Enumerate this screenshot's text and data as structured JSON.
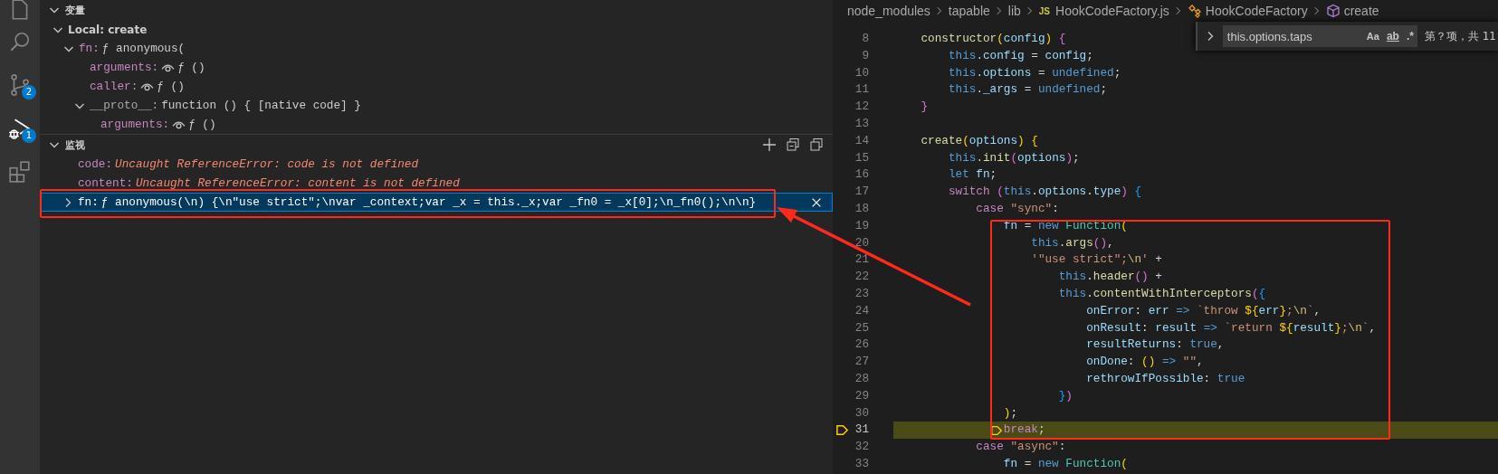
{
  "activity_bar": [
    {
      "kind": "explorer",
      "selected": false
    },
    {
      "kind": "search",
      "selected": false
    },
    {
      "kind": "scm",
      "badge": "2",
      "selected": false
    },
    {
      "kind": "debug",
      "badge": "1",
      "selected": true
    },
    {
      "kind": "extensions",
      "selected": false
    }
  ],
  "variables": {
    "title": "变量",
    "expanded": true,
    "scopes": [
      {
        "label": "Local: create",
        "expanded": true,
        "children": [
          {
            "name": "fn:",
            "value": "ƒ anonymous(",
            "lazy": false,
            "dimmed": false,
            "expanded": true,
            "children": [
              {
                "name": "arguments:",
                "value": "ƒ ()",
                "lazy": true,
                "dimmed": false
              },
              {
                "name": "caller:",
                "value": "ƒ ()",
                "lazy": true,
                "dimmed": false
              },
              {
                "name": "__proto__:",
                "value": "function () { [native code] }",
                "lazy": false,
                "dimmed": true,
                "expanded": true,
                "children": [
                  {
                    "name": "arguments:",
                    "value": "ƒ ()",
                    "lazy": true,
                    "dimmed": false
                  }
                ]
              }
            ]
          }
        ]
      }
    ]
  },
  "watch": {
    "title": "监视",
    "expanded": true,
    "items": [
      {
        "name": "code:",
        "value": "Uncaught ReferenceError: code is not defined",
        "kind": "error",
        "selected": false
      },
      {
        "name": "content:",
        "value": "Uncaught ReferenceError: content is not defined",
        "kind": "error",
        "selected": false
      },
      {
        "name": "fn:",
        "value": "ƒ anonymous(\\n) {\\n\"use strict\";\\nvar _context;var _x = this._x;var _fn0 = _x[0];\\n_fn0();\\n\\n}",
        "kind": "value",
        "selected": true,
        "expanded": false
      }
    ]
  },
  "breadcrumb": [
    {
      "label": "node_modules",
      "kind": "folder"
    },
    {
      "label": "tapable",
      "kind": "folder"
    },
    {
      "label": "lib",
      "kind": "folder"
    },
    {
      "label": "HookCodeFactory.js",
      "kind": "file",
      "badge": "JS"
    },
    {
      "label": "HookCodeFactory",
      "kind": "class"
    },
    {
      "label": "create",
      "kind": "method"
    }
  ],
  "find_widget": {
    "expanded": false,
    "query": "this.options.taps",
    "options": [
      {
        "label": "Aa",
        "kind": "case"
      },
      {
        "label": "ab",
        "kind": "word"
      },
      {
        "label": ".*",
        "kind": "regex"
      }
    ],
    "result": "第？项，共 11"
  },
  "code": {
    "lines": [
      {
        "number": "8",
        "current": false,
        "tokens": [
          {
            "text": "    constructor",
            "kind": "fn"
          },
          {
            "text": "(",
            "kind": "b1"
          },
          {
            "text": "config",
            "kind": "var"
          },
          {
            "text": ")",
            "kind": "b1"
          },
          {
            "text": " {",
            "kind": "b2"
          }
        ]
      },
      {
        "number": "9",
        "current": false,
        "tokens": [
          {
            "text": "        this",
            "kind": "kw"
          },
          {
            "text": ".",
            "kind": "p"
          },
          {
            "text": "config",
            "kind": "var"
          },
          {
            "text": " = ",
            "kind": "p"
          },
          {
            "text": "config",
            "kind": "var"
          },
          {
            "text": ";",
            "kind": "p"
          }
        ]
      },
      {
        "number": "10",
        "current": false,
        "tokens": [
          {
            "text": "        this",
            "kind": "kw"
          },
          {
            "text": ".",
            "kind": "p"
          },
          {
            "text": "options",
            "kind": "var"
          },
          {
            "text": " = ",
            "kind": "p"
          },
          {
            "text": "undefined",
            "kind": "kw"
          },
          {
            "text": ";",
            "kind": "p"
          }
        ]
      },
      {
        "number": "11",
        "current": false,
        "tokens": [
          {
            "text": "        this",
            "kind": "kw"
          },
          {
            "text": ".",
            "kind": "p"
          },
          {
            "text": "_args",
            "kind": "var"
          },
          {
            "text": " = ",
            "kind": "p"
          },
          {
            "text": "undefined",
            "kind": "kw"
          },
          {
            "text": ";",
            "kind": "p"
          }
        ]
      },
      {
        "number": "12",
        "current": false,
        "tokens": [
          {
            "text": "    }",
            "kind": "b2"
          }
        ]
      },
      {
        "number": "13",
        "current": false
      },
      {
        "number": "14",
        "current": false,
        "tokens": [
          {
            "text": "    create",
            "kind": "fn"
          },
          {
            "text": "(",
            "kind": "b1"
          },
          {
            "text": "options",
            "kind": "var"
          },
          {
            "text": ")",
            "kind": "b1"
          },
          {
            "text": " {",
            "kind": "b1"
          }
        ]
      },
      {
        "number": "15",
        "current": false,
        "tokens": [
          {
            "text": "        this",
            "kind": "kw"
          },
          {
            "text": ".",
            "kind": "p"
          },
          {
            "text": "init",
            "kind": "fn"
          },
          {
            "text": "(",
            "kind": "b2"
          },
          {
            "text": "options",
            "kind": "var"
          },
          {
            "text": ")",
            "kind": "b2"
          },
          {
            "text": ";",
            "kind": "p"
          }
        ]
      },
      {
        "number": "16",
        "current": false,
        "tokens": [
          {
            "text": "        let",
            "kind": "kw"
          },
          {
            "text": " fn",
            "kind": "var"
          },
          {
            "text": ";",
            "kind": "p"
          }
        ]
      },
      {
        "number": "17",
        "current": false,
        "tokens": [
          {
            "text": "        switch",
            "kind": "ctl"
          },
          {
            "text": " (",
            "kind": "b2"
          },
          {
            "text": "this",
            "kind": "kw"
          },
          {
            "text": ".",
            "kind": "p"
          },
          {
            "text": "options",
            "kind": "var"
          },
          {
            "text": ".",
            "kind": "p"
          },
          {
            "text": "type",
            "kind": "var"
          },
          {
            "text": ")",
            "kind": "b2"
          },
          {
            "text": " {",
            "kind": "b3"
          }
        ]
      },
      {
        "number": "18",
        "current": false,
        "tokens": [
          {
            "text": "            case",
            "kind": "ctl"
          },
          {
            "text": " \"sync\"",
            "kind": "str"
          },
          {
            "text": ":",
            "kind": "p"
          }
        ]
      },
      {
        "number": "19",
        "current": false,
        "tokens": [
          {
            "text": "                fn",
            "kind": "var"
          },
          {
            "text": " = ",
            "kind": "p"
          },
          {
            "text": "new",
            "kind": "kw"
          },
          {
            "text": " Function",
            "kind": "cls"
          },
          {
            "text": "(",
            "kind": "b1"
          }
        ]
      },
      {
        "number": "20",
        "current": false,
        "tokens": [
          {
            "text": "                    this",
            "kind": "kw"
          },
          {
            "text": ".",
            "kind": "p"
          },
          {
            "text": "args",
            "kind": "fn"
          },
          {
            "text": "()",
            "kind": "b2"
          },
          {
            "text": ",",
            "kind": "p"
          }
        ]
      },
      {
        "number": "21",
        "current": false,
        "tokens": [
          {
            "text": "                    '\"use strict\";",
            "kind": "str"
          },
          {
            "text": "\\n",
            "kind": "esc"
          },
          {
            "text": "'",
            "kind": "str"
          },
          {
            "text": " +",
            "kind": "p"
          }
        ]
      },
      {
        "number": "22",
        "current": false,
        "tokens": [
          {
            "text": "                        this",
            "kind": "kw"
          },
          {
            "text": ".",
            "kind": "p"
          },
          {
            "text": "header",
            "kind": "fn"
          },
          {
            "text": "()",
            "kind": "b2"
          },
          {
            "text": " +",
            "kind": "p"
          }
        ]
      },
      {
        "number": "23",
        "current": false,
        "tokens": [
          {
            "text": "                        this",
            "kind": "kw"
          },
          {
            "text": ".",
            "kind": "p"
          },
          {
            "text": "contentWithInterceptors",
            "kind": "fn"
          },
          {
            "text": "(",
            "kind": "b2"
          },
          {
            "text": "{",
            "kind": "b3"
          }
        ]
      },
      {
        "number": "24",
        "current": false,
        "tokens": [
          {
            "text": "                            onError",
            "kind": "var"
          },
          {
            "text": ": ",
            "kind": "p"
          },
          {
            "text": "err",
            "kind": "var"
          },
          {
            "text": " =>",
            "kind": "kw"
          },
          {
            "text": " `throw ",
            "kind": "str"
          },
          {
            "text": "${",
            "kind": "b1"
          },
          {
            "text": "err",
            "kind": "var"
          },
          {
            "text": "}",
            "kind": "b1"
          },
          {
            "text": ";",
            "kind": "str"
          },
          {
            "text": "\\n",
            "kind": "esc"
          },
          {
            "text": "`",
            "kind": "str"
          },
          {
            "text": ",",
            "kind": "p"
          }
        ]
      },
      {
        "number": "25",
        "current": false,
        "tokens": [
          {
            "text": "                            onResult",
            "kind": "var"
          },
          {
            "text": ": ",
            "kind": "p"
          },
          {
            "text": "result",
            "kind": "var"
          },
          {
            "text": " =>",
            "kind": "kw"
          },
          {
            "text": " `return ",
            "kind": "str"
          },
          {
            "text": "${",
            "kind": "b1"
          },
          {
            "text": "result",
            "kind": "var"
          },
          {
            "text": "}",
            "kind": "b1"
          },
          {
            "text": ";",
            "kind": "str"
          },
          {
            "text": "\\n",
            "kind": "esc"
          },
          {
            "text": "`",
            "kind": "str"
          },
          {
            "text": ",",
            "kind": "p"
          }
        ]
      },
      {
        "number": "26",
        "current": false,
        "tokens": [
          {
            "text": "                            resultReturns",
            "kind": "var"
          },
          {
            "text": ": ",
            "kind": "p"
          },
          {
            "text": "true",
            "kind": "kw"
          },
          {
            "text": ",",
            "kind": "p"
          }
        ]
      },
      {
        "number": "27",
        "current": false,
        "tokens": [
          {
            "text": "                            onDone",
            "kind": "var"
          },
          {
            "text": ": ",
            "kind": "p"
          },
          {
            "text": "()",
            "kind": "b1"
          },
          {
            "text": " =>",
            "kind": "kw"
          },
          {
            "text": " \"\"",
            "kind": "str"
          },
          {
            "text": ",",
            "kind": "p"
          }
        ]
      },
      {
        "number": "28",
        "current": false,
        "tokens": [
          {
            "text": "                            rethrowIfPossible",
            "kind": "var"
          },
          {
            "text": ": ",
            "kind": "p"
          },
          {
            "text": "true",
            "kind": "kw"
          }
        ]
      },
      {
        "number": "29",
        "current": false,
        "tokens": [
          {
            "text": "                        }",
            "kind": "b3"
          },
          {
            "text": ")",
            "kind": "b2"
          }
        ]
      },
      {
        "number": "30",
        "current": false,
        "tokens": [
          {
            "text": "                )",
            "kind": "b1"
          },
          {
            "text": ";",
            "kind": "p"
          }
        ]
      },
      {
        "number": "31",
        "current": true,
        "tokens": [
          {
            "text": "                break",
            "kind": "ctl"
          },
          {
            "text": ";",
            "kind": "p"
          }
        ]
      },
      {
        "number": "32",
        "current": false,
        "tokens": [
          {
            "text": "            case",
            "kind": "ctl"
          },
          {
            "text": " \"async\"",
            "kind": "str"
          },
          {
            "text": ":",
            "kind": "p"
          }
        ]
      },
      {
        "number": "33",
        "current": false,
        "tokens": [
          {
            "text": "                fn",
            "kind": "var"
          },
          {
            "text": " = ",
            "kind": "p"
          },
          {
            "text": "new",
            "kind": "kw"
          },
          {
            "text": " Function",
            "kind": "cls"
          },
          {
            "text": "(",
            "kind": "b1"
          }
        ]
      }
    ]
  }
}
